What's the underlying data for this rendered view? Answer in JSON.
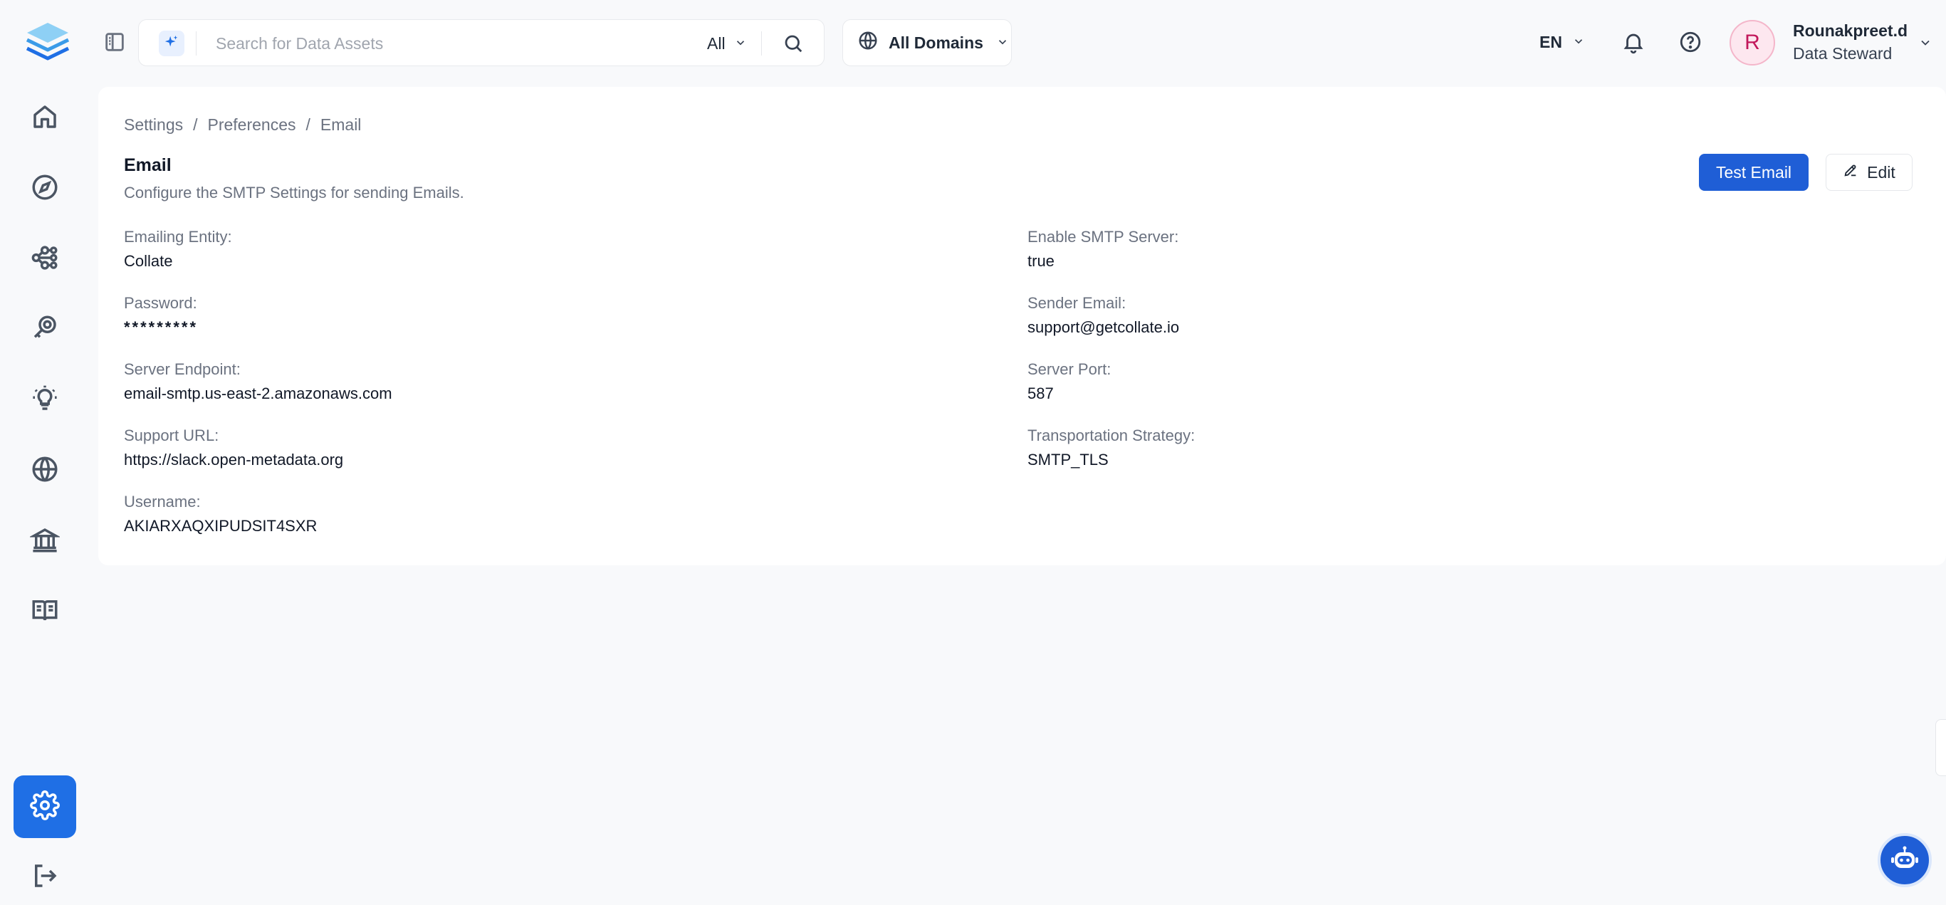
{
  "header": {
    "search": {
      "placeholder": "Search for Data Assets",
      "filter_value": "All"
    },
    "domain_selector": "All Domains",
    "language": "EN",
    "user": {
      "avatar_initial": "R",
      "name": "Rounakpreet.d",
      "role": "Data Steward"
    }
  },
  "sidebar": {
    "items": [
      {
        "icon": "home-icon"
      },
      {
        "icon": "explore-icon"
      },
      {
        "icon": "lineage-icon"
      },
      {
        "icon": "observability-icon"
      },
      {
        "icon": "insights-icon"
      },
      {
        "icon": "domains-icon"
      },
      {
        "icon": "governance-icon"
      },
      {
        "icon": "glossary-icon"
      }
    ],
    "settings_active": true,
    "accent_color": "#1f6fe5"
  },
  "breadcrumb": [
    "Settings",
    "Preferences",
    "Email"
  ],
  "page": {
    "title": "Email",
    "description": "Configure the SMTP Settings for sending Emails.",
    "test_email_label": "Test Email",
    "edit_label": "Edit"
  },
  "fields": {
    "emailing_entity": {
      "label": "Emailing Entity:",
      "value": "Collate"
    },
    "enable_smtp": {
      "label": "Enable SMTP Server:",
      "value": "true"
    },
    "password": {
      "label": "Password:",
      "value": "*********"
    },
    "sender_email": {
      "label": "Sender Email:",
      "value": "support@getcollate.io"
    },
    "server_endpoint": {
      "label": "Server Endpoint:",
      "value": "email-smtp.us-east-2.amazonaws.com"
    },
    "server_port": {
      "label": "Server Port:",
      "value": "587"
    },
    "support_url": {
      "label": "Support URL:",
      "value": "https://slack.open-metadata.org"
    },
    "transport_strategy": {
      "label": "Transportation Strategy:",
      "value": "SMTP_TLS"
    },
    "username": {
      "label": "Username:",
      "value": "AKIARXAQXIPUDSIT4SXR"
    }
  }
}
